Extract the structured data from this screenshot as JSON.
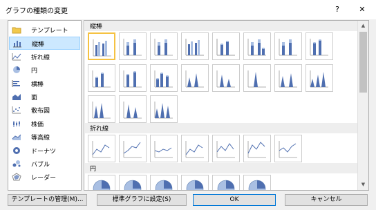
{
  "window": {
    "title": "グラフの種類の変更",
    "help": "?",
    "close": "✕"
  },
  "left_items": [
    {
      "label": "テンプレート",
      "icon": "folder-icon",
      "selected": false
    },
    {
      "label": "縦棒",
      "icon": "column-chart-icon",
      "selected": true
    },
    {
      "label": "折れ線",
      "icon": "line-chart-icon",
      "selected": false
    },
    {
      "label": "円",
      "icon": "pie-chart-icon",
      "selected": false
    },
    {
      "label": "横棒",
      "icon": "bar-chart-icon",
      "selected": false
    },
    {
      "label": "面",
      "icon": "area-chart-icon",
      "selected": false
    },
    {
      "label": "散布図",
      "icon": "scatter-chart-icon",
      "selected": false
    },
    {
      "label": "株価",
      "icon": "stock-chart-icon",
      "selected": false
    },
    {
      "label": "等高線",
      "icon": "surface-chart-icon",
      "selected": false
    },
    {
      "label": "ドーナツ",
      "icon": "doughnut-chart-icon",
      "selected": false
    },
    {
      "label": "バブル",
      "icon": "bubble-chart-icon",
      "selected": false
    },
    {
      "label": "レーダー",
      "icon": "radar-chart-icon",
      "selected": false
    }
  ],
  "sections": {
    "column": "縦棒",
    "line": "折れ線",
    "pie": "円"
  },
  "buttons": {
    "manage_templates": "テンプレートの管理(M)...",
    "set_default": "標準グラフに設定(S)",
    "ok": "OK",
    "cancel": "キャンセル"
  },
  "colors": {
    "selection_border": "#f5c242",
    "chart_blue": "#4f6fb0",
    "light_blue": "#a9bfe3"
  }
}
